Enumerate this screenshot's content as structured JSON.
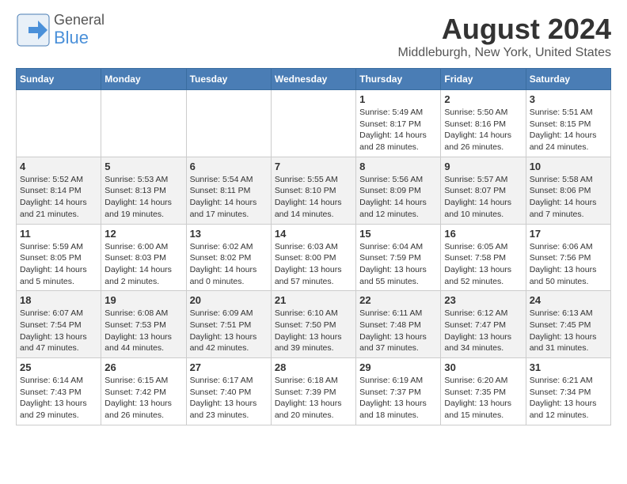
{
  "header": {
    "logo_general": "General",
    "logo_blue": "Blue",
    "title": "August 2024",
    "subtitle": "Middleburgh, New York, United States"
  },
  "calendar": {
    "days_of_week": [
      "Sunday",
      "Monday",
      "Tuesday",
      "Wednesday",
      "Thursday",
      "Friday",
      "Saturday"
    ],
    "weeks": [
      [
        {
          "day": "",
          "detail": ""
        },
        {
          "day": "",
          "detail": ""
        },
        {
          "day": "",
          "detail": ""
        },
        {
          "day": "",
          "detail": ""
        },
        {
          "day": "1",
          "detail": "Sunrise: 5:49 AM\nSunset: 8:17 PM\nDaylight: 14 hours\nand 28 minutes."
        },
        {
          "day": "2",
          "detail": "Sunrise: 5:50 AM\nSunset: 8:16 PM\nDaylight: 14 hours\nand 26 minutes."
        },
        {
          "day": "3",
          "detail": "Sunrise: 5:51 AM\nSunset: 8:15 PM\nDaylight: 14 hours\nand 24 minutes."
        }
      ],
      [
        {
          "day": "4",
          "detail": "Sunrise: 5:52 AM\nSunset: 8:14 PM\nDaylight: 14 hours\nand 21 minutes."
        },
        {
          "day": "5",
          "detail": "Sunrise: 5:53 AM\nSunset: 8:13 PM\nDaylight: 14 hours\nand 19 minutes."
        },
        {
          "day": "6",
          "detail": "Sunrise: 5:54 AM\nSunset: 8:11 PM\nDaylight: 14 hours\nand 17 minutes."
        },
        {
          "day": "7",
          "detail": "Sunrise: 5:55 AM\nSunset: 8:10 PM\nDaylight: 14 hours\nand 14 minutes."
        },
        {
          "day": "8",
          "detail": "Sunrise: 5:56 AM\nSunset: 8:09 PM\nDaylight: 14 hours\nand 12 minutes."
        },
        {
          "day": "9",
          "detail": "Sunrise: 5:57 AM\nSunset: 8:07 PM\nDaylight: 14 hours\nand 10 minutes."
        },
        {
          "day": "10",
          "detail": "Sunrise: 5:58 AM\nSunset: 8:06 PM\nDaylight: 14 hours\nand 7 minutes."
        }
      ],
      [
        {
          "day": "11",
          "detail": "Sunrise: 5:59 AM\nSunset: 8:05 PM\nDaylight: 14 hours\nand 5 minutes."
        },
        {
          "day": "12",
          "detail": "Sunrise: 6:00 AM\nSunset: 8:03 PM\nDaylight: 14 hours\nand 2 minutes."
        },
        {
          "day": "13",
          "detail": "Sunrise: 6:02 AM\nSunset: 8:02 PM\nDaylight: 14 hours\nand 0 minutes."
        },
        {
          "day": "14",
          "detail": "Sunrise: 6:03 AM\nSunset: 8:00 PM\nDaylight: 13 hours\nand 57 minutes."
        },
        {
          "day": "15",
          "detail": "Sunrise: 6:04 AM\nSunset: 7:59 PM\nDaylight: 13 hours\nand 55 minutes."
        },
        {
          "day": "16",
          "detail": "Sunrise: 6:05 AM\nSunset: 7:58 PM\nDaylight: 13 hours\nand 52 minutes."
        },
        {
          "day": "17",
          "detail": "Sunrise: 6:06 AM\nSunset: 7:56 PM\nDaylight: 13 hours\nand 50 minutes."
        }
      ],
      [
        {
          "day": "18",
          "detail": "Sunrise: 6:07 AM\nSunset: 7:54 PM\nDaylight: 13 hours\nand 47 minutes."
        },
        {
          "day": "19",
          "detail": "Sunrise: 6:08 AM\nSunset: 7:53 PM\nDaylight: 13 hours\nand 44 minutes."
        },
        {
          "day": "20",
          "detail": "Sunrise: 6:09 AM\nSunset: 7:51 PM\nDaylight: 13 hours\nand 42 minutes."
        },
        {
          "day": "21",
          "detail": "Sunrise: 6:10 AM\nSunset: 7:50 PM\nDaylight: 13 hours\nand 39 minutes."
        },
        {
          "day": "22",
          "detail": "Sunrise: 6:11 AM\nSunset: 7:48 PM\nDaylight: 13 hours\nand 37 minutes."
        },
        {
          "day": "23",
          "detail": "Sunrise: 6:12 AM\nSunset: 7:47 PM\nDaylight: 13 hours\nand 34 minutes."
        },
        {
          "day": "24",
          "detail": "Sunrise: 6:13 AM\nSunset: 7:45 PM\nDaylight: 13 hours\nand 31 minutes."
        }
      ],
      [
        {
          "day": "25",
          "detail": "Sunrise: 6:14 AM\nSunset: 7:43 PM\nDaylight: 13 hours\nand 29 minutes."
        },
        {
          "day": "26",
          "detail": "Sunrise: 6:15 AM\nSunset: 7:42 PM\nDaylight: 13 hours\nand 26 minutes."
        },
        {
          "day": "27",
          "detail": "Sunrise: 6:17 AM\nSunset: 7:40 PM\nDaylight: 13 hours\nand 23 minutes."
        },
        {
          "day": "28",
          "detail": "Sunrise: 6:18 AM\nSunset: 7:39 PM\nDaylight: 13 hours\nand 20 minutes."
        },
        {
          "day": "29",
          "detail": "Sunrise: 6:19 AM\nSunset: 7:37 PM\nDaylight: 13 hours\nand 18 minutes."
        },
        {
          "day": "30",
          "detail": "Sunrise: 6:20 AM\nSunset: 7:35 PM\nDaylight: 13 hours\nand 15 minutes."
        },
        {
          "day": "31",
          "detail": "Sunrise: 6:21 AM\nSunset: 7:34 PM\nDaylight: 13 hours\nand 12 minutes."
        }
      ]
    ]
  }
}
